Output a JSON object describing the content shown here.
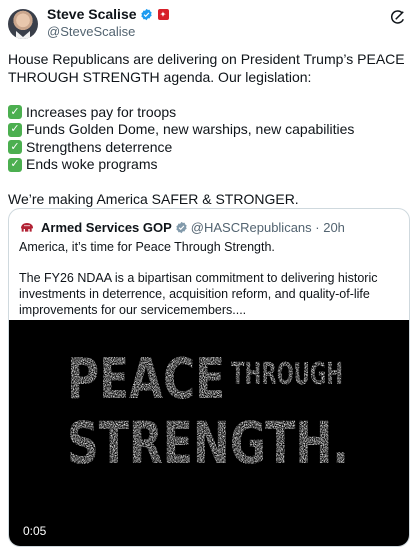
{
  "author": {
    "name": "Steve Scalise",
    "handle": "@SteveScalise"
  },
  "tweet": {
    "intro": "House Republicans are delivering on President Trump’s PEACE THROUGH STRENGTH agenda. Our legislation:",
    "items": [
      "Increases pay for troops",
      "Funds Golden Dome, new warships, new capabilities",
      "Strengthens deterrence",
      "Ends woke programs"
    ],
    "closing": "We’re making America SAFER & STRONGER."
  },
  "quote": {
    "name": "Armed Services GOP",
    "handle_time": "@HASCRepublicans · 20h",
    "line1": "America, it’s time for Peace Through Strength.",
    "line2": "The FY26 NDAA is a bipartisan commitment to delivering historic investments in deterrence, acquisition reform, and quality-of-life improvements for our servicemembers....",
    "video": {
      "word1": "PEACE",
      "word2": "THROUGH",
      "word3": "STRENGTH.",
      "time": "0:05"
    }
  },
  "colors": {
    "verified": "#1d9bf0",
    "check": "#4caf50",
    "flag": "#d71f29"
  }
}
